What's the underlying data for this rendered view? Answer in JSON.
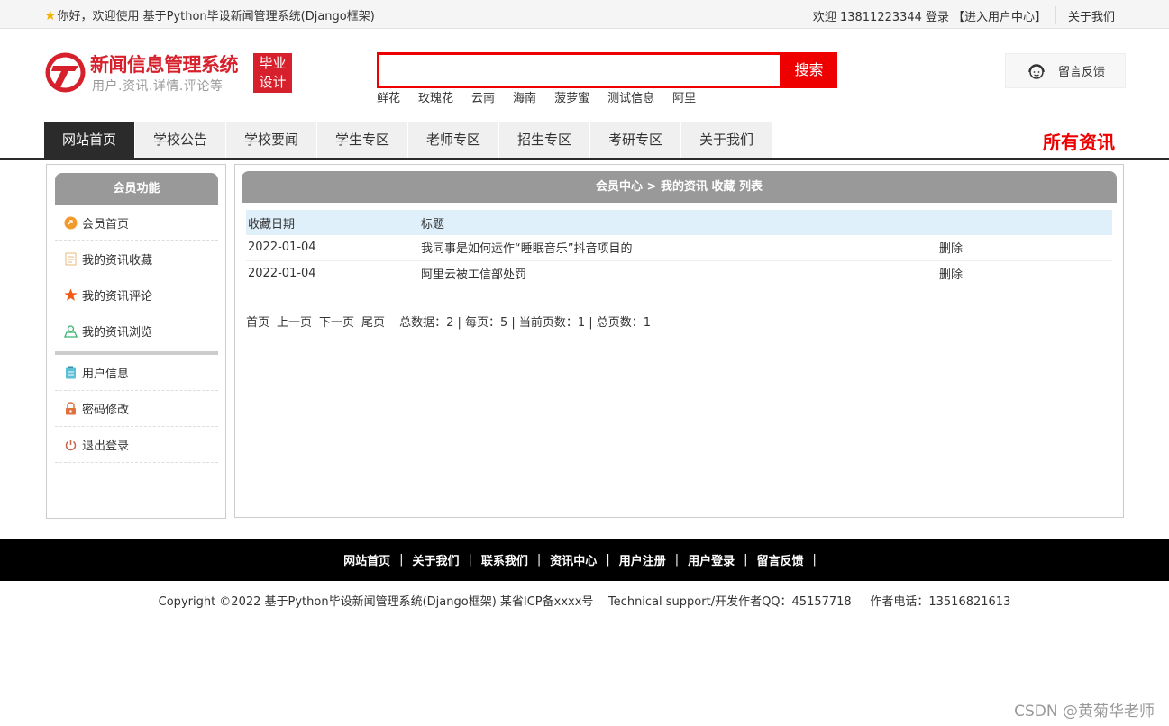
{
  "topbar": {
    "welcome": "你好，欢迎使用 基于Python毕设新闻管理系统(Django框架)",
    "user_welcome": "欢迎 13811223344",
    "login": "登录",
    "user_center": "【进入用户中心】",
    "about": "关于我们"
  },
  "header": {
    "logo_title": "新闻信息管理系统",
    "logo_sub": "用户.资讯.详情.评论等",
    "badge_line1": "毕业",
    "badge_line2": "设计",
    "search_placeholder": "",
    "search_button": "搜索",
    "hotwords": [
      "鲜花",
      "玫瑰花",
      "云南",
      "海南",
      "菠萝蜜",
      "测试信息",
      "阿里"
    ],
    "feedback": "留言反馈"
  },
  "nav": {
    "items": [
      "网站首页",
      "学校公告",
      "学校要闻",
      "学生专区",
      "老师专区",
      "招生专区",
      "考研专区",
      "关于我们"
    ],
    "all_news": "所有资讯"
  },
  "sidebar": {
    "title": "会员功能",
    "items": [
      {
        "label": "会员首页",
        "icon": "home-icon"
      },
      {
        "label": "我的资讯收藏",
        "icon": "document-icon"
      },
      {
        "label": "我的资讯评论",
        "icon": "star-icon"
      },
      {
        "label": "我的资讯浏览",
        "icon": "user-view-icon"
      }
    ],
    "items2": [
      {
        "label": "用户信息",
        "icon": "clipboard-icon"
      },
      {
        "label": "密码修改",
        "icon": "lock-icon"
      },
      {
        "label": "退出登录",
        "icon": "power-icon"
      }
    ]
  },
  "main": {
    "title": "会员中心 > 我的资讯 收藏 列表",
    "columns": [
      "收藏日期",
      "标题",
      ""
    ],
    "rows": [
      {
        "date": "2022-01-04",
        "title": "我同事是如何运作“睡眠音乐”抖音项目的",
        "action": "删除"
      },
      {
        "date": "2022-01-04",
        "title": "阿里云被工信部处罚",
        "action": "删除"
      }
    ],
    "pager": {
      "first": "首页",
      "prev": "上一页",
      "next": "下一页",
      "last": "尾页",
      "summary": "总数据：2 | 每页：5 | 当前页数：1 | 总页数：1"
    }
  },
  "footer": {
    "links": [
      "网站首页",
      "关于我们",
      "联系我们",
      "资讯中心",
      "用户注册",
      "用户登录",
      "留言反馈"
    ],
    "copyright": "Copyright ©2022 基于Python毕设新闻管理系统(Django框架) 某省ICP备xxxx号    Technical support/开发作者QQ：45157718     作者电话：13516821613"
  },
  "watermark": "CSDN @黄菊华老师",
  "colors": {
    "accent": "#e00000",
    "nav_active": "#2b2b2b",
    "panel_head": "#999999"
  }
}
